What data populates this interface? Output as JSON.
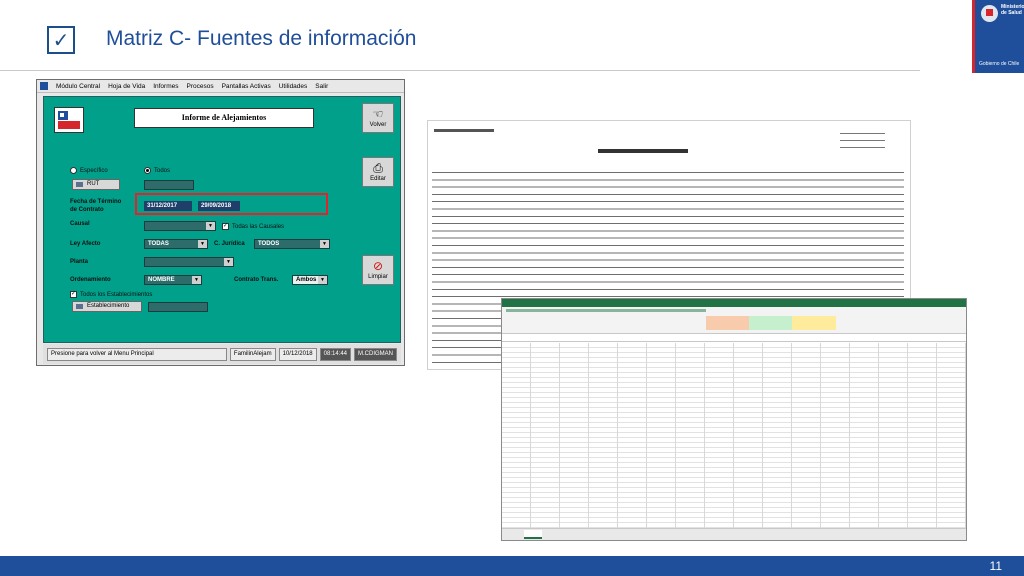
{
  "slide": {
    "title": "Matriz C- Fuentes de información",
    "checkmark": "✓",
    "page_number": "11",
    "logo": {
      "ministry": "Ministerio de Salud",
      "government": "Gobierno de Chile"
    }
  },
  "app": {
    "menu": [
      "Módulo Central",
      "Hoja de Vida",
      "Informes",
      "Procesos",
      "Pantallas Activas",
      "Utilidades",
      "Salir"
    ],
    "form_title": "Informe de Alejamientos",
    "buttons": {
      "back": "Volver",
      "edit": "Editar",
      "clean": "Limpiar",
      "rut": "RUT",
      "establishment": "Establecimiento"
    },
    "filters": {
      "radio_specific": "Específico",
      "radio_all": "Todos",
      "term_date_label_1": "Fecha de Término",
      "term_date_label_2": "de Contrato",
      "date_from": "31/12/2017",
      "date_to": "29/09/2018",
      "cause_label": "Causal",
      "all_causes": "Todas las Causales",
      "law_label": "Ley Afecto",
      "law_value": "TODAS",
      "juridic_label": "C. Jurídica",
      "juridic_value": "TODOS",
      "staff_label": "Planta",
      "order_label": "Ordenamiento",
      "order_value": "NOMBRE",
      "contract_label": "Contrato Trans.",
      "contract_value": "Ambos",
      "all_establishments": "Todos los Establecimientos"
    },
    "status": {
      "message": "Presione para volver al Menu Principal",
      "user": "FamilinAlejam",
      "date": "10/12/2018",
      "time": "08:14:44",
      "operator": "M.CDIGMAN"
    }
  },
  "icons": {
    "check": "checkbox-check-icon",
    "back": "hand-back-icon",
    "edit": "printer-icon",
    "clean": "no-entry-icon"
  },
  "colors": {
    "accent": "#1f4e9a",
    "form_bg": "#00a08a",
    "highlight": "#e0242b",
    "excel": "#217346"
  }
}
